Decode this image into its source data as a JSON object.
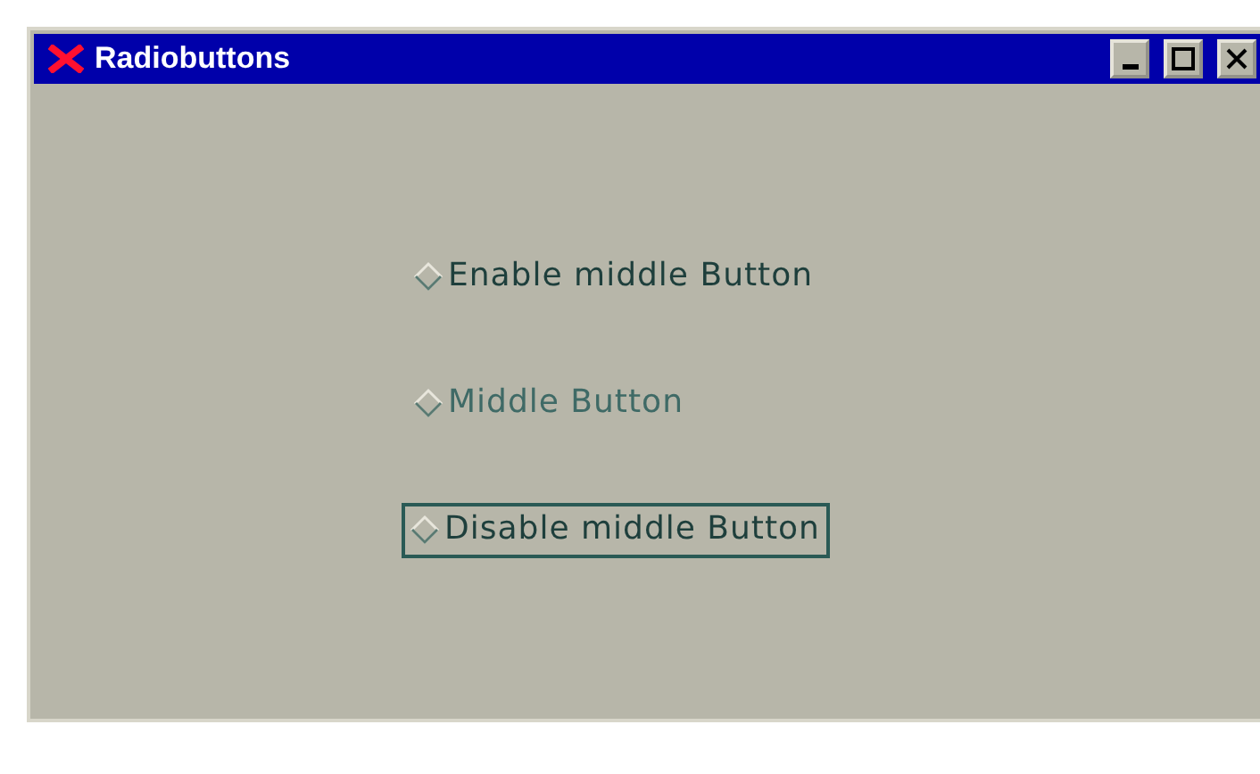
{
  "window": {
    "title": "Radiobuttons"
  },
  "radios": [
    {
      "label": "Enable middle Button",
      "selected": false,
      "disabled": false,
      "focused": false
    },
    {
      "label": "Middle Button",
      "selected": false,
      "disabled": true,
      "focused": false
    },
    {
      "label": "Disable middle Button",
      "selected": false,
      "disabled": false,
      "focused": true
    }
  ]
}
